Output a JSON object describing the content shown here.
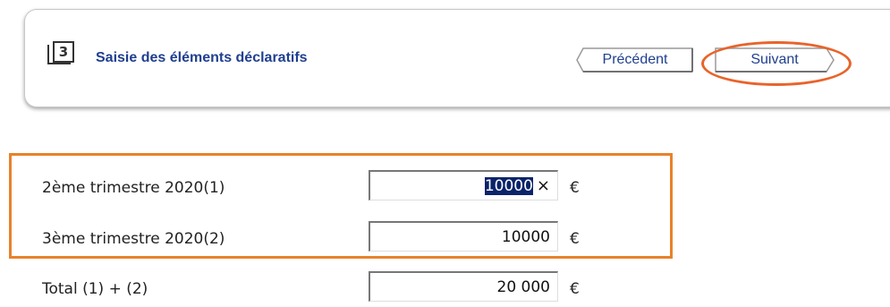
{
  "header": {
    "step_number": "3",
    "title": "Saisie des éléments déclaratifs",
    "prev_label": "Précédent",
    "next_label": "Suivant"
  },
  "form": {
    "rows": [
      {
        "label": "2ème trimestre 2020(1)",
        "value": "10000",
        "unit": "€",
        "clear": "×",
        "selected": true
      },
      {
        "label": "3ème trimestre 2020(2)",
        "value": "10000",
        "unit": "€"
      },
      {
        "label": "Total (1) + (2)",
        "value": "20 000",
        "unit": "€"
      }
    ]
  },
  "colors": {
    "title": "#1f3f8f",
    "highlight": "#e8642a",
    "selection": "#0a246a"
  },
  "icons": {
    "step": "step-3-icon",
    "clear": "clear-icon"
  }
}
